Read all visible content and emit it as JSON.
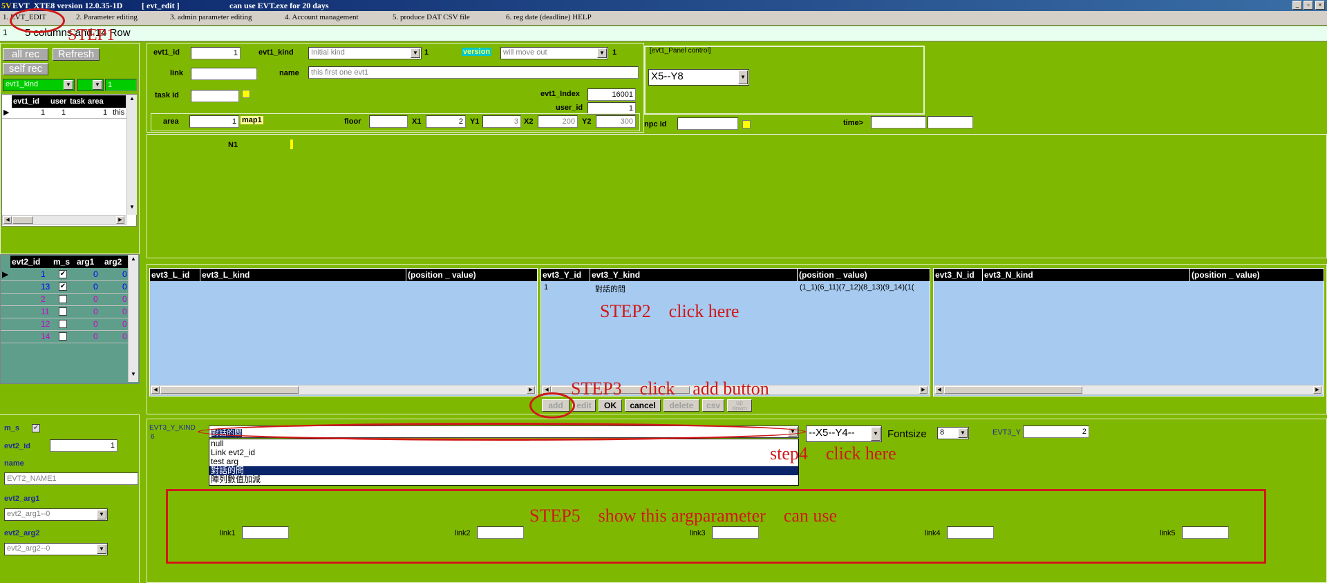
{
  "titlebar": {
    "app": "EVT_XTE8 version 12.0.35-1D",
    "form": "[ evt_edit ]",
    "notice": "can use EVT.exe for 20 days",
    "btn_min": "_",
    "btn_max": "▫",
    "btn_close": "×"
  },
  "menu": {
    "items": [
      "1. EVT_EDIT",
      "2. Parameter editing",
      "3. admin parameter editing",
      "4. Account management",
      "5. produce DAT CSV file",
      "6. reg date (deadline) HELP"
    ]
  },
  "status": {
    "line": "5 columns and 14 Row",
    "index": "1"
  },
  "left": {
    "all_rec": "all rec",
    "refresh": "Refresh",
    "self_rec": "self rec",
    "filter_kind": "evt1_kind",
    "filter_num": "1",
    "grid1": {
      "headers": [
        "evt1_id",
        "user",
        "task",
        "area"
      ],
      "rows": [
        {
          "evt1_id": "1",
          "user": "1",
          "task": "",
          "area": "1",
          "extra": "this"
        }
      ]
    },
    "grid2": {
      "headers": [
        "evt2_id",
        "m_s",
        "arg1",
        "arg2"
      ],
      "rows": [
        {
          "id": "1",
          "ms": "✔",
          "arg1": "0",
          "arg2": "0"
        },
        {
          "id": "13",
          "ms": "✔",
          "arg1": "0",
          "arg2": "0"
        },
        {
          "id": "2",
          "ms": "",
          "arg1": "0",
          "arg2": "0"
        },
        {
          "id": "11",
          "ms": "",
          "arg1": "0",
          "arg2": "0"
        },
        {
          "id": "12",
          "ms": "",
          "arg1": "0",
          "arg2": "0"
        },
        {
          "id": "14",
          "ms": "",
          "arg1": "0",
          "arg2": "0"
        }
      ]
    },
    "ms_label": "m_s",
    "ms_check": "✔",
    "evt2_id_label": "evt2_id",
    "evt2_id_value": "1",
    "name_label": "name",
    "name_value": "EVT2_NAME1",
    "arg1_label": "evt2_arg1",
    "arg1_value": "evt2_arg1--0",
    "arg2_label": "evt2_arg2",
    "arg2_value": "evt2_arg2--0"
  },
  "form": {
    "evt1_id_label": "evt1_id",
    "evt1_id_value": "1",
    "evt1_kind_label": "evt1_kind",
    "evt1_kind_value": "Initial kind",
    "kind_num": "1",
    "version_label": "version",
    "version_value": "will move out",
    "version_num": "1",
    "link_label": "link",
    "name_label": "name",
    "name_value": "this first one evt1",
    "task_id_label": "task id",
    "evt1_index_label": "evt1_Index",
    "evt1_index_value": "16001",
    "user_id_label": "user_id",
    "user_id_value": "1",
    "area_label": "area",
    "area_value": "1",
    "map": "map1",
    "floor_label": "floor",
    "x1_label": "X1",
    "x1_value": "2",
    "y1_label": "Y1",
    "y1_value": "3",
    "x2_label": "X2",
    "x2_value": "200",
    "y2_label": "Y2",
    "y2_value": "300",
    "panel_control_label": "[evt1_Panel control]",
    "panel_control_value": "X5--Y8",
    "npc_id_label": "npc id",
    "time_label": "time>",
    "n1_label": "N1"
  },
  "grids": {
    "l": {
      "headers": [
        "evt3_L_id",
        "evt3_L_kind",
        "(position _ value)"
      ]
    },
    "y": {
      "headers": [
        "evt3_Y_id",
        "evt3_Y_kind",
        "(position _ value)"
      ],
      "rows": [
        {
          "id": "1",
          "kind": "對話的問",
          "pos": "(1_1)(6_11)(7_12)(8_13)(9_14)(1("
        }
      ]
    },
    "n": {
      "headers": [
        "evt3_N_id",
        "evt3_N_kind",
        "(position _ value)"
      ]
    }
  },
  "buttons": {
    "add": "add",
    "edit": "edit",
    "ok": "OK",
    "cancel": "cancel",
    "delete": "delete",
    "csv": "csv",
    "updown": "up down"
  },
  "detail": {
    "y_kind_label": "EVT3_Y_KIND",
    "y_kind_sub": "6",
    "kind_selected": "對話的問",
    "dropdown_options": [
      "null",
      "Link evt2_id",
      "test arg",
      "對話的問",
      "陣列數值加減"
    ],
    "dropdown_selected_index": 3,
    "xy_value": "--X5--Y4--",
    "fontsize_label": "Fontsize",
    "fontsize_value": "8",
    "evt3_y_label": "EVT3_Y",
    "evt3_y_value": "2",
    "links": [
      "link1",
      "link2",
      "link3",
      "link4",
      "link5"
    ]
  },
  "annotations": {
    "step1": "STEP1",
    "step2": "STEP2　click here",
    "step3": "STEP3　click　add button",
    "step4": "step4　click here",
    "step5": "STEP5　show this argparameter　can use"
  },
  "colors": {
    "panel_green": "#7fb800",
    "grid_blue": "#a6caf0",
    "teal": "#5f9e8a",
    "annotation_red": "#d01818"
  }
}
